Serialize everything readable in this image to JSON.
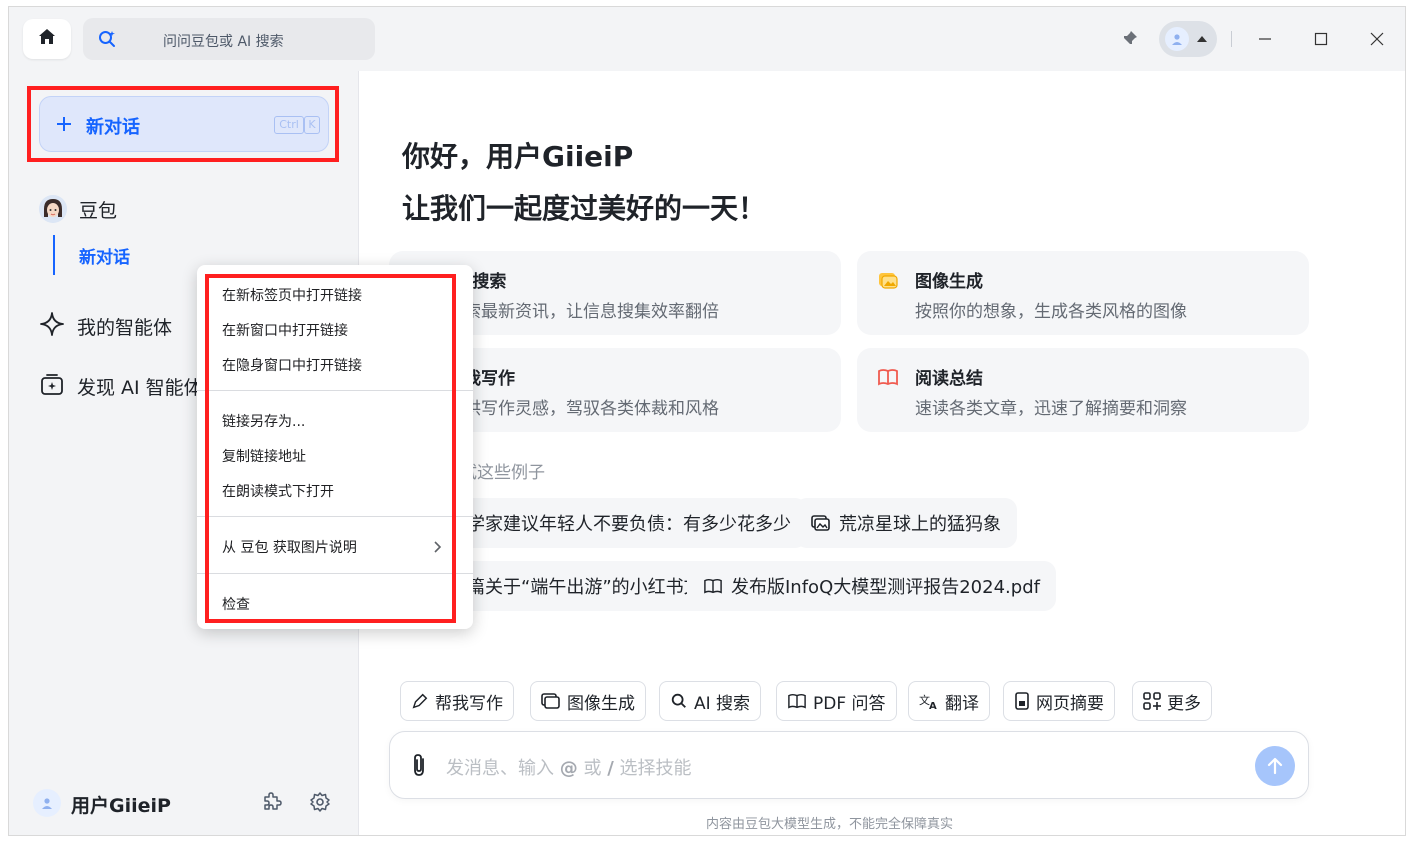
{
  "titlebar": {
    "search_placeholder": "问问豆包或 AI 搜索",
    "icons": [
      "home-icon",
      "ai-search-icon",
      "pin-icon",
      "user-avatar-icon",
      "minimize-icon",
      "maximize-icon",
      "close-icon"
    ]
  },
  "sidebar": {
    "new_chat_label": "新对话",
    "shortcut_ctrl": "Ctrl",
    "shortcut_key": "K",
    "bot_name": "豆包",
    "active_chat": "新对话",
    "my_agents": "我的智能体",
    "discover_agents": "发现 AI 智能体",
    "user_name": "用户GiieiP"
  },
  "main": {
    "greeting_line1": "你好，用户GiieiP",
    "greeting_line2": "让我们一起度过美好的一天！",
    "cards": [
      {
        "title": "AI 搜索",
        "desc": "搜索最新资讯，让信息搜集效率翻倍",
        "icon": "ai-search-icon"
      },
      {
        "title": "图像生成",
        "desc": "按照你的想象，生成各类风格的图像",
        "icon": "image-gen-icon"
      },
      {
        "title": "帮我写作",
        "desc": "提供写作灵感，驾驭各类体裁和风格",
        "icon": "writing-icon"
      },
      {
        "title": "阅读总结",
        "desc": "速读各类文章，迅速了解摘要和洞察",
        "icon": "book-icon"
      }
    ],
    "examples_label": "试试这些例子",
    "examples": [
      {
        "text": "经济学家建议年轻人不要负债：有多少花多少",
        "icon": "search-icon"
      },
      {
        "text": "荒凉星球上的猛犸象",
        "icon": "image-icon"
      },
      {
        "text": "写一篇关于“端午出游”的小红书文案",
        "icon": "pen-icon"
      },
      {
        "text": "发布版InfoQ大模型测评报告2024.pdf",
        "icon": "book-icon"
      }
    ],
    "skills": [
      {
        "label": "帮我写作",
        "icon": "pen-icon"
      },
      {
        "label": "图像生成",
        "icon": "image-icon"
      },
      {
        "label": "AI 搜索",
        "icon": "ai-search-icon"
      },
      {
        "label": "PDF 问答",
        "icon": "book-icon"
      },
      {
        "label": "翻译",
        "icon": "translate-icon"
      },
      {
        "label": "网页摘要",
        "icon": "webpage-icon"
      },
      {
        "label": "更多",
        "icon": "more-grid-icon"
      }
    ],
    "composer": {
      "ph_part1": "发消息、输入 ",
      "ph_at": "@",
      "ph_part2": " 或 ",
      "ph_slash": "/",
      "ph_part3": " 选择技能"
    },
    "disclaimer": "内容由豆包大模型生成，不能完全保障真实"
  },
  "context_menu": {
    "items": [
      "在新标签页中打开链接",
      "在新窗口中打开链接",
      "在隐身窗口中打开链接",
      "链接另存为...",
      "复制链接地址",
      "在朗读模式下打开",
      "从 豆包 获取图片说明",
      "检查"
    ]
  },
  "colors": {
    "accent": "#1664ff",
    "highlight_frame": "#ff1f1f",
    "sidebar_bg": "#f3f4f6",
    "card_bg": "#f5f6f8"
  }
}
